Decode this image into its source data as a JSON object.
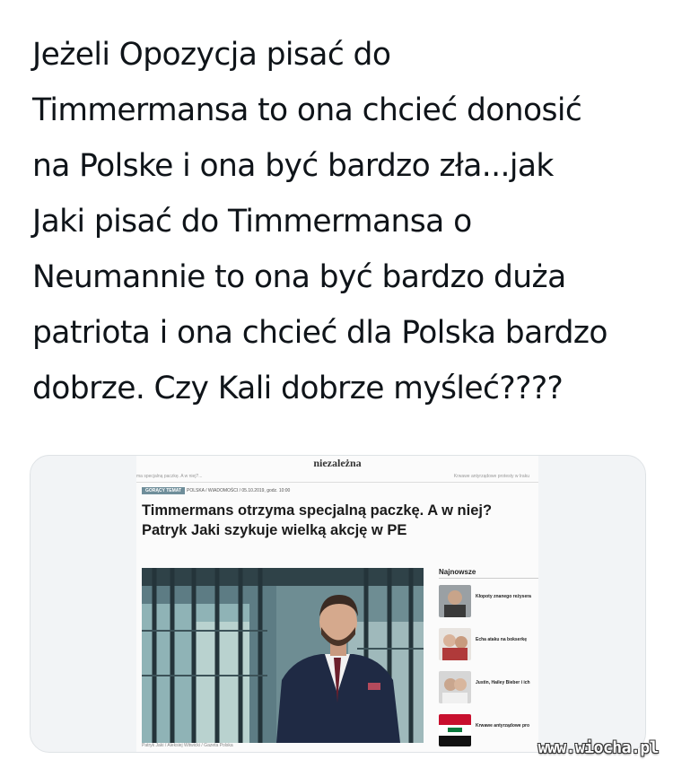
{
  "tweet": {
    "lines": [
      "Jeżeli Opozycja pisać do",
      "Timmermansa to ona chcieć donosić",
      "na Polske i ona być bardzo zła...jak",
      "Jaki pisać do Timmermansa o",
      "Neumannie to ona być bardzo duża",
      "patriota i ona chcieć dla Polska bardzo",
      "dobrze. Czy Kali dobrze myśleć????"
    ]
  },
  "article": {
    "masthead": "niezależna",
    "sub_left": "ma specjalną paczkę. A w niej?...",
    "sub_right": "Krwawe antyrządowe protesty w Iraku",
    "tag": "GORĄCY TEMAT",
    "meta": "POLSKA / WIADOMOŚCI / 05.10.2019, godz. 10:00",
    "headline_lines": [
      "Timmermans otrzyma specjalną paczkę. A w niej?",
      "Patryk Jaki szykuje wielką akcję w PE"
    ],
    "caption": "Patryk Jaki / Aleksiej Witwicki / Gazeta Polska"
  },
  "sidebar": {
    "title": "Najnowsze",
    "items": [
      "Kłopoty znanego reżysera",
      "Echa ataku na bokserkę",
      "Justin, Hailey Bieber i ich",
      "Krwawe antyrządowe pro"
    ]
  },
  "watermark": "www.wiocha.pl",
  "colors": {
    "tag_bg": "#6f8e9a",
    "card_border": "#dfe3e6",
    "text": "#0f1419"
  }
}
